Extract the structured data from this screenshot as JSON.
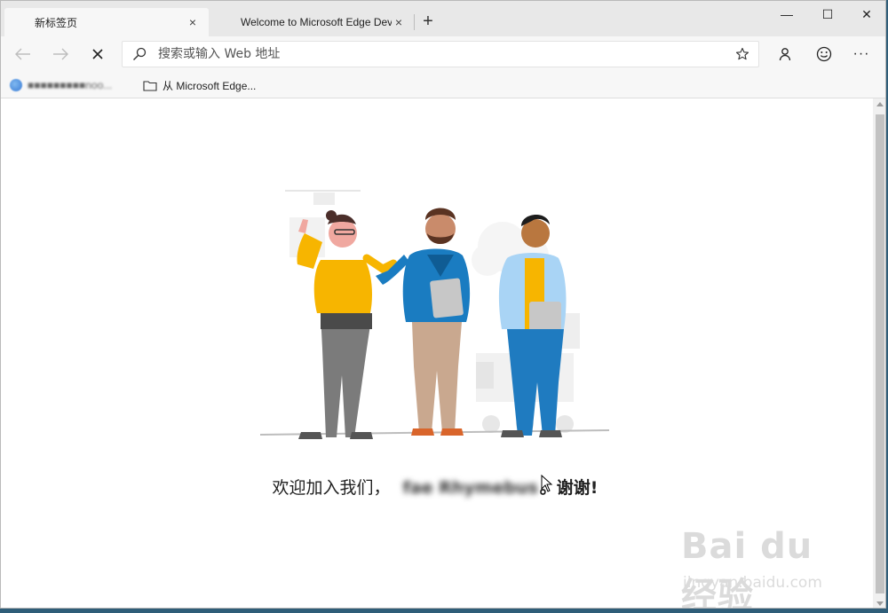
{
  "tabs": [
    {
      "title": "新标签页",
      "active": true,
      "close": "×"
    },
    {
      "title": "Welcome to Microsoft Edge Dev",
      "active": false,
      "close": "×"
    }
  ],
  "new_tab": "+",
  "window_controls": {
    "minimize": "—",
    "maximize": "☐",
    "close": "✕"
  },
  "address": {
    "placeholder": "搜索或输入 Web 地址",
    "value": ""
  },
  "toolbar": {
    "more": "···"
  },
  "favorites": [
    {
      "label": "■■■■■■■■■noo..."
    },
    {
      "label": "从 Microsoft Edge..."
    }
  ],
  "welcome": {
    "prefix": "欢迎加入我们，",
    "name": "fae Rhymebus",
    "suffix": "。谢谢!"
  },
  "watermark": {
    "brand": "Bai du 经验",
    "url": "jingyan.baidu.com"
  },
  "colors": {
    "accent": "#0f6cbd",
    "tabstrip": "#e8e8e8",
    "toolbar": "#f7f7f7"
  }
}
